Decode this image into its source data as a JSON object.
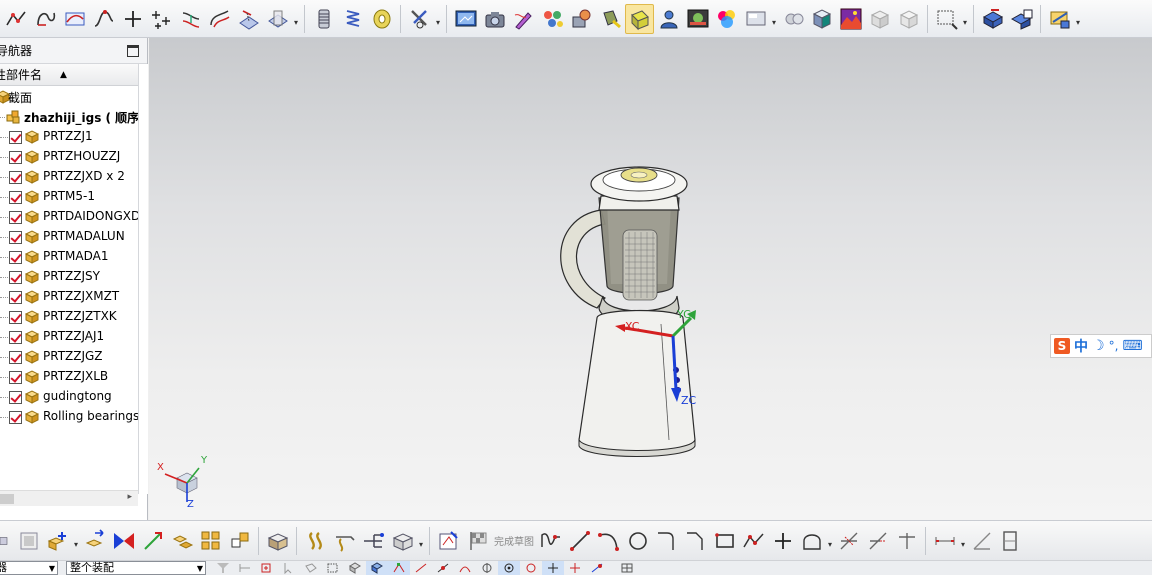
{
  "navigator": {
    "title": "导航器",
    "column_header": "性部件名",
    "section_label": "截面",
    "root_label": "zhazhiji_igs ( 顺序 :",
    "parts": [
      "PRTZZJ1",
      "PRTZHOUZZJ",
      "PRTZZJXD x 2",
      "PRTM5-1",
      "PRTDAIDONGXD",
      "PRTMADALUN",
      "PRTMADA1",
      "PRTZZJSY",
      "PRTZZJXMZT",
      "PRTZZJZTXK",
      "PRTZZJAJ1",
      "PRTZZJGZ",
      "PRTZZJXLB",
      "gudingtong",
      "Rolling bearings"
    ]
  },
  "viewport": {
    "axis_labels": {
      "xc": "XC",
      "yc": "YC",
      "zc": "ZC"
    },
    "triad_labels": {
      "x": "X",
      "y": "Y",
      "z": "Z"
    }
  },
  "ime": {
    "mode": "中",
    "punct": "°,"
  },
  "bottom_toolbar": {
    "finish_sketch": "完成草图",
    "filter_select": "器",
    "assembly_select": "整个装配"
  },
  "colors": {
    "accent_active": "#f9e6a0",
    "check_red": "#d4142a",
    "axis_x": "#d42020",
    "axis_y": "#2ea43a",
    "axis_z": "#1a3fd6"
  }
}
